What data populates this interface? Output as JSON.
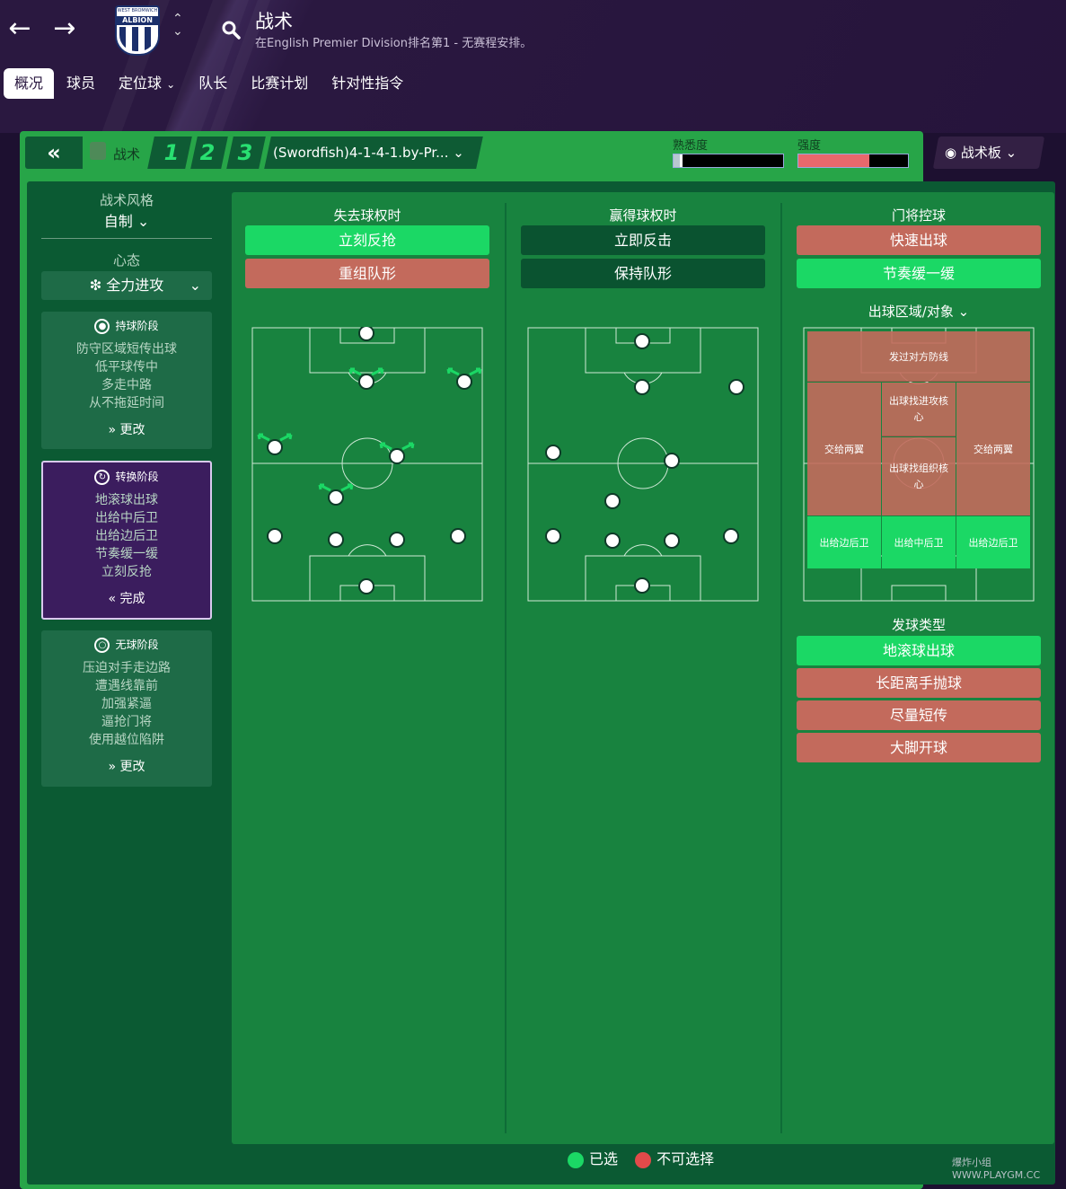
{
  "header": {
    "title": "战术",
    "subtitle": "在English Premier Division排名第1 - 无赛程安排。",
    "club_crest_text": "ALBION",
    "club_crest_top": "WEST BROMWICH"
  },
  "tabs": [
    {
      "label": "概况",
      "active": true
    },
    {
      "label": "球员"
    },
    {
      "label": "定位球",
      "dropdown": true
    },
    {
      "label": "队长"
    },
    {
      "label": "比赛计划"
    },
    {
      "label": "针对性指令"
    }
  ],
  "toolbar": {
    "collapse_icon": "double-chevron-left-icon",
    "tactic_label": "战术",
    "slots": [
      "1",
      "2",
      "3"
    ],
    "formation": "(Swordfish)4-1-4-1.by-Pr...",
    "familiarity_label": "熟悉度",
    "familiarity_level": 0.08,
    "intensity_label": "强度",
    "intensity_level": 0.65,
    "board_button": "战术板"
  },
  "left_panel": {
    "style_label": "战术风格",
    "style_value": "自制",
    "mentality_label": "心态",
    "mentality_value": "全力进攻",
    "cards": [
      {
        "title": "持球阶段",
        "lines": [
          "防守区域短传出球",
          "低平球传中",
          "多走中路",
          "从不拖延时间"
        ],
        "footer": "更改"
      },
      {
        "title": "转换阶段",
        "lines": [
          "地滚球出球",
          "出给中后卫",
          "出给边后卫",
          "节奏缓一缓",
          "立刻反抢"
        ],
        "footer": "完成"
      },
      {
        "title": "无球阶段",
        "lines": [
          "压迫对手走边路",
          "遭遇线靠前",
          "加强紧逼",
          "逼抢门将",
          "使用越位陷阱"
        ],
        "footer": "更改"
      }
    ]
  },
  "columns": {
    "lose_ball": {
      "title": "失去球权时",
      "options": [
        {
          "label": "立刻反抢",
          "state": "selected"
        },
        {
          "label": "重组队形",
          "state": "unavailable"
        }
      ]
    },
    "win_ball": {
      "title": "赢得球权时",
      "options": [
        {
          "label": "立即反击",
          "state": "neutral"
        },
        {
          "label": "保持队形",
          "state": "neutral"
        }
      ]
    },
    "goalkeeper": {
      "title": "门将控球",
      "options": [
        {
          "label": "快速出球",
          "state": "unavailable"
        },
        {
          "label": "节奏缓一缓",
          "state": "selected"
        }
      ]
    }
  },
  "distribution": {
    "area_label": "出球区域/对象",
    "zones": {
      "top": "发过对方防线",
      "left_wing": "交给两翼",
      "right_wing": "交给两翼",
      "center_top": "出球找进攻核心",
      "center_mid": "出球找组织核心",
      "bottom_left": "出给边后卫",
      "bottom_center": "出给中后卫",
      "bottom_right": "出给边后卫"
    },
    "type_label": "发球类型",
    "types": [
      {
        "label": "地滚球出球",
        "state": "selected"
      },
      {
        "label": "长距离手抛球",
        "state": "unavailable"
      },
      {
        "label": "尽量短传",
        "state": "unavailable"
      },
      {
        "label": "大脚开球",
        "state": "unavailable"
      }
    ]
  },
  "legend": {
    "selected": "已选",
    "unavailable": "不可选择"
  },
  "colors": {
    "selected": "#1bd865",
    "unavailable": "#e24a4a",
    "accent_purple": "#3b1d5e"
  },
  "watermark": "爆炸小组 WWW.PLAYGM.CC"
}
